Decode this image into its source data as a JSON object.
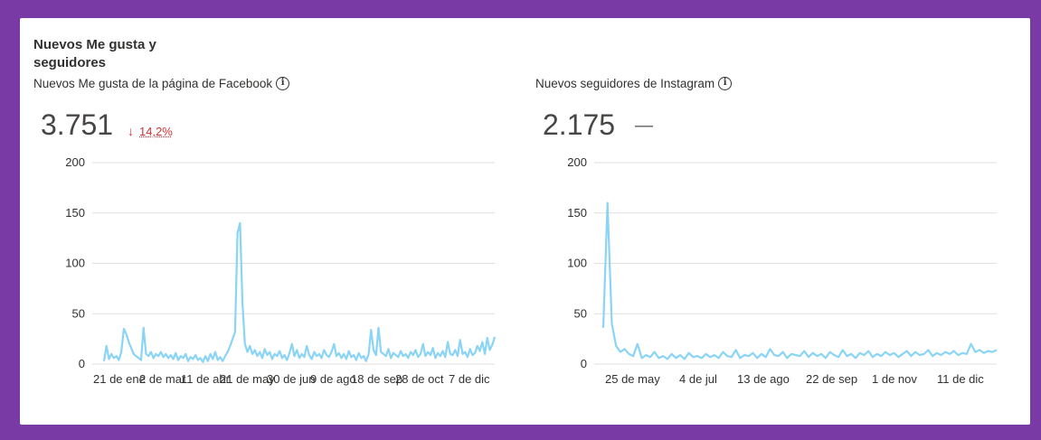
{
  "section": {
    "title": "Nuevos Me gusta y seguidores"
  },
  "facebook": {
    "title": "Nuevos Me gusta de la página de Facebook",
    "value": "3.751",
    "change": "14,2%",
    "change_direction": "down",
    "change_color": "#d13438"
  },
  "instagram": {
    "title": "Nuevos seguidores de Instagram",
    "value": "2.175",
    "change": "—"
  },
  "colors": {
    "frame": "#7a3aa6",
    "line": "#8ad4f5",
    "grid": "#e1dfdd"
  },
  "chart_data": [
    {
      "type": "line",
      "ylim": [
        0,
        200
      ],
      "yticks": [
        0,
        50,
        100,
        150,
        200
      ],
      "x_tick_labels": [
        "21 de ene",
        "2 de mar",
        "11 de abr",
        "21 de may",
        "30 de jun",
        "9 de ago",
        "18 de sep",
        "28 de oct",
        "7 de dic"
      ],
      "grid": true,
      "series": [
        {
          "values": [
            3,
            18,
            5,
            10,
            6,
            8,
            4,
            12,
            35,
            30,
            22,
            16,
            10,
            8,
            6,
            4,
            36,
            10,
            8,
            12,
            6,
            10,
            8,
            12,
            7,
            10,
            6,
            9,
            5,
            11,
            4,
            8,
            6,
            10,
            3,
            7,
            5,
            9,
            4,
            6,
            2,
            8,
            3,
            10,
            5,
            12,
            4,
            7,
            3,
            8,
            12,
            18,
            25,
            32,
            130,
            140,
            60,
            20,
            12,
            18,
            10,
            14,
            8,
            12,
            6,
            15,
            9,
            12,
            5,
            10,
            8,
            13,
            6,
            9,
            4,
            11,
            20,
            8,
            14,
            6,
            10,
            7,
            18,
            9,
            5,
            12,
            8,
            10,
            6,
            14,
            9,
            7,
            12,
            20,
            8,
            11,
            6,
            10,
            5,
            13,
            7,
            9,
            4,
            11,
            6,
            8,
            3,
            10,
            34,
            14,
            9,
            36,
            12,
            10,
            8,
            15,
            6,
            11,
            9,
            7,
            13,
            8,
            10,
            6,
            12,
            9,
            14,
            7,
            10,
            20,
            8,
            12,
            9,
            16,
            6,
            11,
            8,
            13,
            7,
            22,
            10,
            9,
            14,
            8,
            24,
            10,
            12,
            7,
            15,
            9,
            11,
            18,
            13,
            22,
            10,
            26,
            14,
            19,
            27
          ]
        }
      ]
    },
    {
      "type": "line",
      "ylim": [
        0,
        200
      ],
      "yticks": [
        0,
        50,
        100,
        150,
        200
      ],
      "x_tick_labels": [
        "25 de may",
        "4 de jul",
        "13 de ago",
        "22 de sep",
        "1 de nov",
        "11 de dic"
      ],
      "grid": true,
      "series": [
        {
          "values": [
            36,
            160,
            40,
            18,
            12,
            15,
            10,
            8,
            20,
            6,
            9,
            7,
            12,
            6,
            8,
            5,
            10,
            6,
            9,
            5,
            11,
            7,
            8,
            6,
            10,
            7,
            9,
            6,
            12,
            8,
            7,
            14,
            6,
            9,
            8,
            11,
            6,
            10,
            7,
            15,
            9,
            8,
            12,
            6,
            10,
            9,
            8,
            13,
            7,
            11,
            8,
            10,
            6,
            12,
            9,
            7,
            14,
            8,
            10,
            6,
            11,
            9,
            13,
            7,
            10,
            8,
            12,
            9,
            11,
            7,
            10,
            13,
            8,
            12,
            9,
            10,
            14,
            8,
            11,
            9,
            12,
            10,
            13,
            9,
            11,
            10,
            20,
            12,
            14,
            11,
            13,
            12,
            14
          ]
        }
      ]
    }
  ]
}
